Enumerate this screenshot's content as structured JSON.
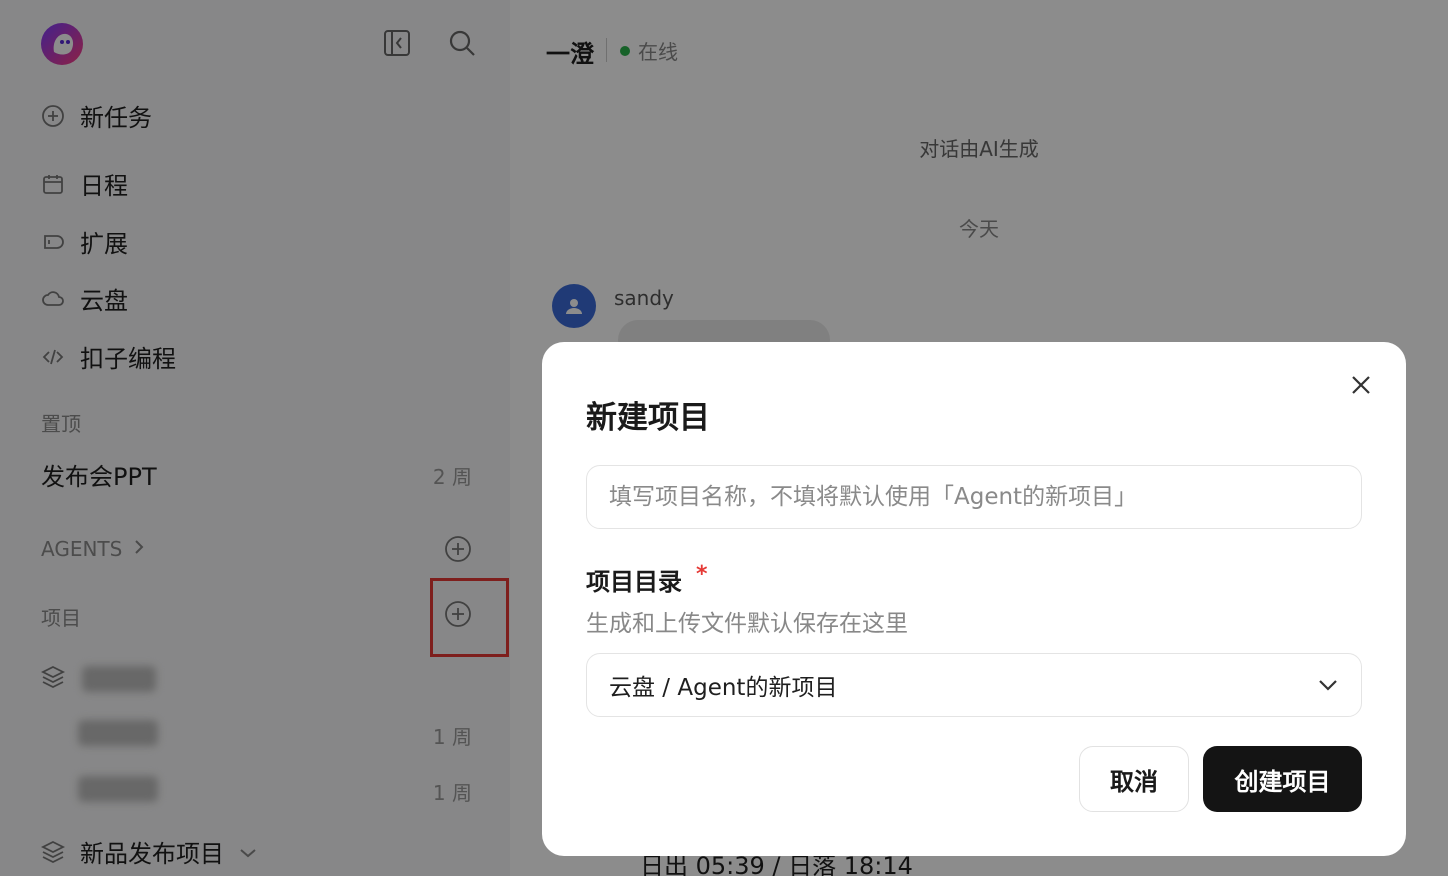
{
  "sidebar": {
    "nav": [
      {
        "label": "新任务",
        "icon": "plus-circle-icon"
      },
      {
        "label": "日程",
        "icon": "calendar-icon"
      },
      {
        "label": "扩展",
        "icon": "extension-icon"
      },
      {
        "label": "云盘",
        "icon": "cloud-icon"
      },
      {
        "label": "扣子编程",
        "icon": "code-icon"
      }
    ],
    "pinned_label": "置顶",
    "pinned_item": {
      "label": "发布会PPT",
      "time": "2 周"
    },
    "agents_label": "AGENTS",
    "projects_label": "项目",
    "project_rows": [
      {
        "time": "1 周"
      },
      {
        "time": "1 周"
      }
    ],
    "project_group": "新品发布项目"
  },
  "main": {
    "chat_title": "一澄",
    "status": "在线",
    "ai_note": "对话由AI生成",
    "date_separator": "今天",
    "username": "sandy",
    "bottom_text": "日出 05:39 / 日落 18:14"
  },
  "dialog": {
    "title": "新建项目",
    "name_placeholder": "填写项目名称，不填将默认使用「Agent的新项目」",
    "name_value": "",
    "dir_label": "项目目录",
    "required_mark": "*",
    "dir_hint": "生成和上传文件默认保存在这里",
    "dir_selected": "云盘 / Agent的新项目",
    "cancel_label": "取消",
    "create_label": "创建项目"
  },
  "colors": {
    "accent_dark": "#141414",
    "status_online": "#2bb24c",
    "required": "#e53935",
    "highlight": "#e53935",
    "avatar": "#3b6bd8"
  }
}
